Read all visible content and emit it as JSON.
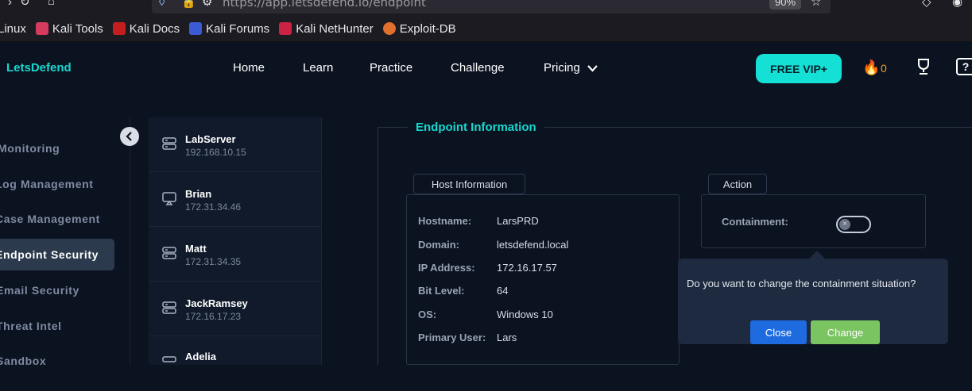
{
  "browser": {
    "url": "https://app.letsdefend.io/endpoint",
    "zoom": "90%",
    "bookmarks": [
      {
        "label": "Linux",
        "color": "transparent"
      },
      {
        "label": "Kali Tools",
        "color": "#d43b5e"
      },
      {
        "label": "Kali Docs",
        "color": "#c41e1e"
      },
      {
        "label": "Kali Forums",
        "color": "#3b5bd4"
      },
      {
        "label": "Kali NetHunter",
        "color": "#cc2244"
      },
      {
        "label": "Exploit-DB",
        "color": "#e0702b"
      }
    ]
  },
  "nav": {
    "brand": "LetsDefend",
    "links": [
      "Home",
      "Learn",
      "Practice",
      "Challenge",
      "Pricing"
    ],
    "vip_label": "FREE VIP+",
    "streak_count": "0"
  },
  "sidebar": {
    "items": [
      {
        "label": "Monitoring"
      },
      {
        "label": "Log Management"
      },
      {
        "label": "Case Management"
      },
      {
        "label": "Endpoint Security",
        "active": true
      },
      {
        "label": "Email Security"
      },
      {
        "label": "Threat Intel"
      },
      {
        "label": "Sandbox"
      }
    ]
  },
  "hosts": [
    {
      "name": "LabServer",
      "ip": "192.168.10.15",
      "icon": "server-icon"
    },
    {
      "name": "Brian",
      "ip": "172.31.34.46",
      "icon": "monitor-icon"
    },
    {
      "name": "Matt",
      "ip": "172.31.34.35",
      "icon": "server-icon"
    },
    {
      "name": "JackRamsey",
      "ip": "172.16.17.23",
      "icon": "server-icon"
    },
    {
      "name": "Adelia",
      "ip": "",
      "icon": "server-icon"
    }
  ],
  "endpoint": {
    "title": "Endpoint Information",
    "host_tab": "Host Information",
    "action_tab": "Action",
    "info": [
      {
        "key": "Hostname:",
        "value": "LarsPRD"
      },
      {
        "key": "Domain:",
        "value": "letsdefend.local"
      },
      {
        "key": "IP Address:",
        "value": "172.16.17.57"
      },
      {
        "key": "Bit Level:",
        "value": "64"
      },
      {
        "key": "OS:",
        "value": "Windows 10"
      },
      {
        "key": "Primary User:",
        "value": "Lars"
      }
    ],
    "containment_label": "Containment:",
    "containment_on": false
  },
  "popover": {
    "message": "Do you want to change the containment situation?",
    "close_label": "Close",
    "change_label": "Change"
  }
}
